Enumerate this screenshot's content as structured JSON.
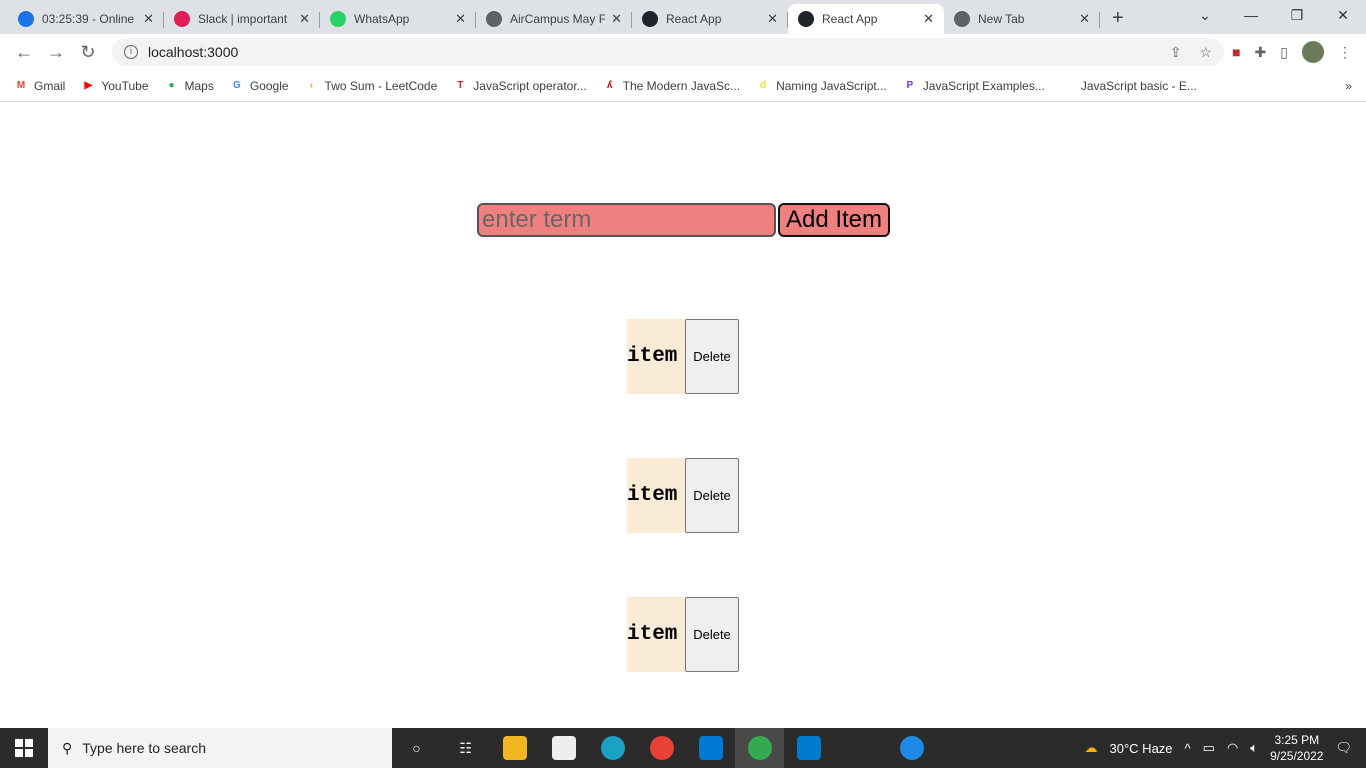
{
  "browser": {
    "tabs": [
      {
        "title": "03:25:39 - Online",
        "color": "#1a73e8",
        "active": false
      },
      {
        "title": "Slack | important",
        "color": "#e01e5a",
        "active": false
      },
      {
        "title": "WhatsApp",
        "color": "#25d366",
        "active": false
      },
      {
        "title": "AirCampus May F",
        "color": "#5f6368",
        "active": false
      },
      {
        "title": "React App",
        "color": "#20232a",
        "active": false
      },
      {
        "title": "React App",
        "color": "#20232a",
        "active": true
      },
      {
        "title": "New Tab",
        "color": "#5f6368",
        "active": false
      }
    ],
    "url": "localhost:3000",
    "bookmarks": [
      {
        "label": "Gmail",
        "icon": "M",
        "color": "#ea4335"
      },
      {
        "label": "YouTube",
        "icon": "▶",
        "color": "#ff0000"
      },
      {
        "label": "Maps",
        "icon": "●",
        "color": "#34a853"
      },
      {
        "label": "Google",
        "icon": "G",
        "color": "#4285f4"
      },
      {
        "label": "Two Sum - LeetCode",
        "icon": "‹",
        "color": "#f89f1b"
      },
      {
        "label": "JavaScript operator...",
        "icon": "T",
        "color": "#e21b1b"
      },
      {
        "label": "The Modern JavaSc...",
        "icon": "ʎ",
        "color": "#c00"
      },
      {
        "label": "Naming JavaScript...",
        "icon": "d",
        "color": "#f7df1e"
      },
      {
        "label": "JavaScript Examples...",
        "icon": "P",
        "color": "#7b2ff7"
      },
      {
        "label": "JavaScript basic - E...",
        "icon": "w3r",
        "color": "#888"
      }
    ]
  },
  "app": {
    "input_placeholder": "enter term",
    "add_label": "Add Item",
    "items": [
      {
        "label": "item",
        "delete": "Delete"
      },
      {
        "label": "item",
        "delete": "Delete"
      },
      {
        "label": "item",
        "delete": "Delete"
      }
    ]
  },
  "taskbar": {
    "search_placeholder": "Type here to search",
    "weather": "30°C  Haze",
    "time": "3:25 PM",
    "date": "9/25/2022"
  }
}
